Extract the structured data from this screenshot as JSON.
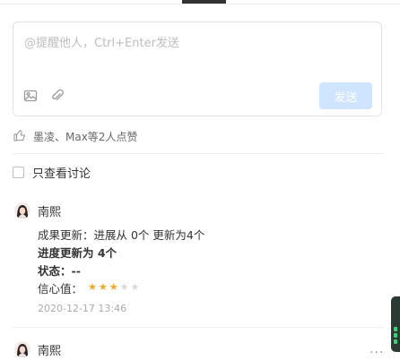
{
  "composer": {
    "placeholder": "@提醒他人，Ctrl+Enter发送",
    "send_label": "发送"
  },
  "likes": {
    "text": "墨凌、Max等2人点赞"
  },
  "filter": {
    "label": "只查看讨论"
  },
  "comments": [
    {
      "author": "南熙",
      "line1": "成果更新：进展从 0个 更新为4个",
      "line2": "进度更新为 4个",
      "line3": "状态：--",
      "confidence_label": "信心值：",
      "confidence_rating": 3,
      "confidence_max": 5,
      "timestamp": "2020-12-17 13:46"
    },
    {
      "author": "南熙",
      "more": "···"
    }
  ],
  "colors": {
    "accent_disabled": "#cfe5ff",
    "star_on": "#f5a623",
    "star_off": "#d9d9d9"
  }
}
